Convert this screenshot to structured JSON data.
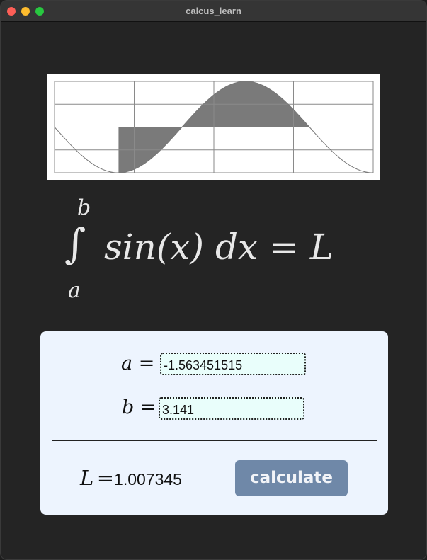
{
  "window": {
    "title": "calcus_learn"
  },
  "formula": {
    "upper_limit": "b",
    "lower_limit": "a",
    "integral_sign": "∫",
    "expression": "sin(x) dx = L"
  },
  "inputs": {
    "a_label": "a",
    "a_eq": "=",
    "a_value": "-1.563451515",
    "b_label": "b",
    "b_eq": "=",
    "b_value": "3.141"
  },
  "result": {
    "label": "L",
    "eq": "=",
    "value": "1.007345"
  },
  "actions": {
    "calculate_label": "calculate"
  },
  "chart_data": {
    "type": "area",
    "curve": "sin(x)",
    "x_range": [
      -3.14159,
      4.71239
    ],
    "ylim": [
      -1,
      1
    ],
    "shaded_interval": [
      -1.563451515,
      3.141
    ],
    "grid": true,
    "colors": {
      "curve": "#777777",
      "fill": "#7a7a7a",
      "grid": "#8a8a8a",
      "background": "#ffffff"
    }
  }
}
